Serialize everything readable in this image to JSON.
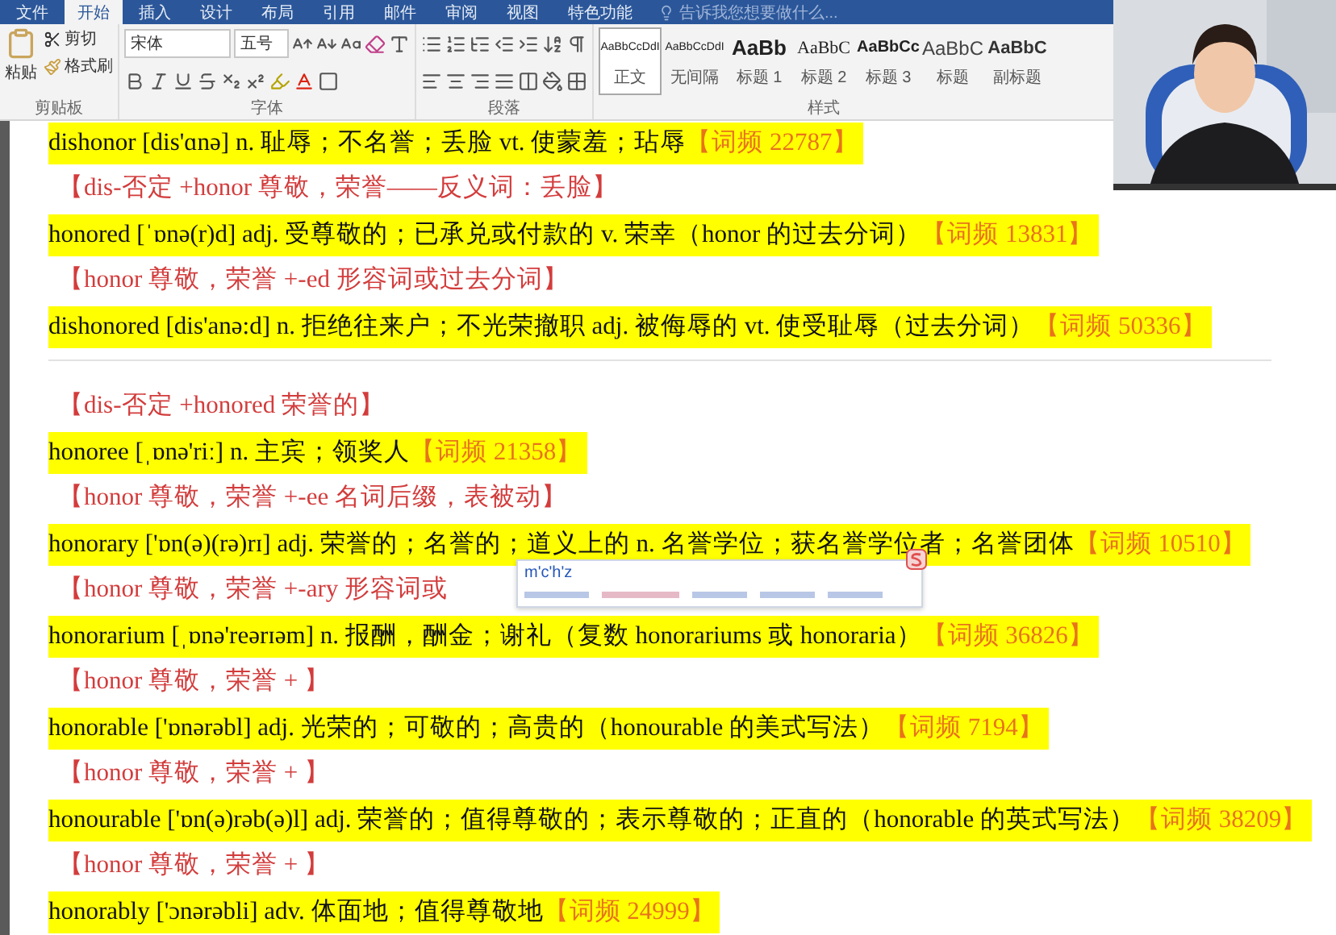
{
  "ribbon": {
    "tabs": [
      {
        "label": "文件",
        "selected": false
      },
      {
        "label": "开始",
        "selected": true
      },
      {
        "label": "插入",
        "selected": false
      },
      {
        "label": "设计",
        "selected": false
      },
      {
        "label": "布局",
        "selected": false
      },
      {
        "label": "引用",
        "selected": false
      },
      {
        "label": "邮件",
        "selected": false
      },
      {
        "label": "审阅",
        "selected": false
      },
      {
        "label": "视图",
        "selected": false
      },
      {
        "label": "特色功能",
        "selected": false
      }
    ],
    "search": {
      "placeholder": "告诉我您想要做什么..."
    },
    "clipboard": {
      "paste": "粘贴",
      "cut": "剪切",
      "format_painter": "格式刷",
      "label": "剪贴板"
    },
    "font": {
      "name": "宋体",
      "size": "五号",
      "label": "字体"
    },
    "paragraph": {
      "label": "段落"
    },
    "styles": {
      "label": "样式",
      "items": [
        {
          "kind": "body",
          "preview": "AaBbCcDdI",
          "name": "正文",
          "selected": true
        },
        {
          "kind": "body",
          "preview": "AaBbCcDdI",
          "name": "无间隔",
          "selected": false
        },
        {
          "kind": "heading1",
          "preview": "AaBb",
          "name": "标题 1",
          "selected": false
        },
        {
          "kind": "heading2",
          "preview": "AaBbC",
          "name": "标题 2",
          "selected": false
        },
        {
          "kind": "heading3",
          "preview": "AaBbCc",
          "name": "标题 3",
          "selected": false
        },
        {
          "kind": "title",
          "preview": "AaBbC",
          "name": "标题",
          "selected": false
        },
        {
          "kind": "subtitle",
          "preview": "AaBbC",
          "name": "副标题",
          "selected": false
        }
      ]
    }
  },
  "document": {
    "lines": [
      {
        "kind": "entry",
        "text": "dishonor [dis'ɑnə] n. 耻辱；不名誉；丢脸 vt. 使蒙羞；玷辱",
        "frequency": "【词频 22787】"
      },
      {
        "kind": "note",
        "text": "【dis-否定 +honor 尊敬，荣誉——反义词：丢脸】"
      },
      {
        "kind": "entry",
        "text": "honored [ˈɒnə(r)d] adj. 受尊敬的；已承兑或付款的 v. 荣幸（honor 的过去分词）",
        "frequency": "【词频 13831】"
      },
      {
        "kind": "note",
        "text": "【honor 尊敬，荣誉 +-ed 形容词或过去分词】"
      },
      {
        "kind": "entry",
        "text": "dishonored [dis'anə:d] n. 拒绝往来户；不光荣撤职 adj. 被侮辱的 vt. 使受耻辱（过去分词）",
        "frequency": "【词频 50336】"
      },
      {
        "kind": "divider"
      },
      {
        "kind": "note",
        "text": "【dis-否定 +honored 荣誉的】"
      },
      {
        "kind": "entry",
        "text": "honoree [ˌɒnə'riː] n. 主宾；领奖人",
        "frequency": "【词频 21358】"
      },
      {
        "kind": "note",
        "text": "【honor 尊敬，荣誉 +-ee 名词后缀，表被动】"
      },
      {
        "kind": "entry",
        "text": "honorary ['ɒn(ə)(rə)rɪ] adj. 荣誉的；名誉的；道义上的 n. 名誉学位；获名誉学位者；名誉团体",
        "frequency": "【词频 10510】"
      },
      {
        "kind": "note",
        "text": "【honor 尊敬，荣誉 +-ary 形容词或",
        "ime": {
          "composition": "m'c'h'z"
        }
      },
      {
        "kind": "entry",
        "text": "honorarium [ˌɒnə'reərɪəm] n. 报酬，酬金；谢礼（复数 honorariums 或 honoraria）",
        "frequency": "【词频 36826】"
      },
      {
        "kind": "note",
        "text": "【honor 尊敬，荣誉 + 】"
      },
      {
        "kind": "entry",
        "text": "honorable ['ɒnərəbl] adj. 光荣的；可敬的；高贵的（honourable 的美式写法）",
        "frequency": "【词频 7194】"
      },
      {
        "kind": "note",
        "text": "【honor 尊敬，荣誉 + 】"
      },
      {
        "kind": "entry",
        "text": "honourable ['ɒn(ə)rəb(ə)l] adj. 荣誉的；值得尊敬的；表示尊敬的；正直的（honorable 的英式写法）",
        "frequency": "【词频 38209】"
      },
      {
        "kind": "note",
        "text": "【honor 尊敬，荣誉 + 】"
      },
      {
        "kind": "entry",
        "text": "honorably ['ɔnərəbli] adv. 体面地；值得尊敬地",
        "frequency": "【词频 24999】"
      }
    ]
  }
}
